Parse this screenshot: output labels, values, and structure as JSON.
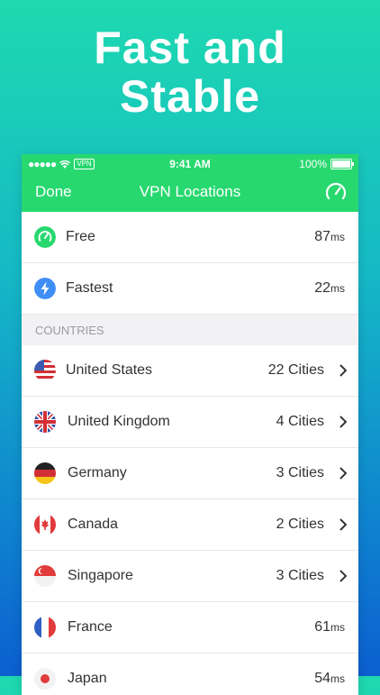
{
  "headline": {
    "line1": "Fast and",
    "line2": "Stable"
  },
  "status_bar": {
    "signal": "●●●●●",
    "vpn_badge": "VPN",
    "time": "9:41 AM",
    "battery": "100%"
  },
  "navbar": {
    "done_label": "Done",
    "title": "VPN Locations",
    "speed_icon": "speedometer-icon",
    "accent_color": "#27d86f"
  },
  "quick": [
    {
      "label": "Free",
      "latency": "87",
      "unit": "ms",
      "icon": "speedometer-icon"
    },
    {
      "label": "Fastest",
      "latency": "22",
      "unit": "ms",
      "icon": "lightning-icon"
    }
  ],
  "section_header": "COUNTRIES",
  "countries": [
    {
      "name": "United States",
      "value": "22 Cities",
      "icon": "us-flag-icon"
    },
    {
      "name": "United Kingdom",
      "value": "4 Cities",
      "icon": "uk-flag-icon"
    },
    {
      "name": "Germany",
      "value": "3 Cities",
      "icon": "germany-flag-icon"
    },
    {
      "name": "Canada",
      "value": "2 Cities",
      "icon": "canada-flag-icon"
    },
    {
      "name": "Singapore",
      "value": "3 Cities",
      "icon": "singapore-flag-icon"
    },
    {
      "name": "France",
      "latency": "61",
      "unit": "ms",
      "icon": "france-flag-icon"
    },
    {
      "name": "Japan",
      "latency": "54",
      "unit": "ms",
      "icon": "japan-flag-icon"
    }
  ]
}
